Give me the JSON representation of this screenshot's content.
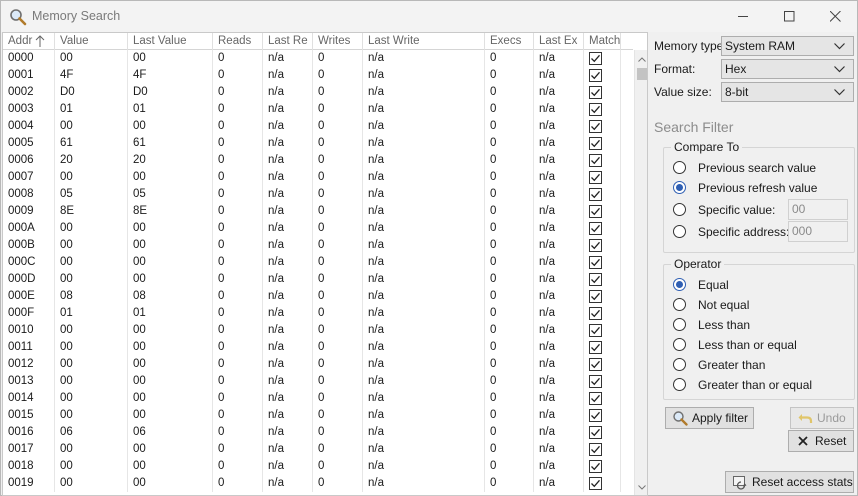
{
  "window": {
    "title": "Memory Search",
    "icon": "magnifier-icon",
    "controls": [
      "minimize-icon",
      "maximize-icon",
      "close-icon"
    ]
  },
  "grid": {
    "columns": [
      "Addr",
      "Value",
      "Last Value",
      "Reads",
      "Last Re",
      "Writes",
      "Last Write",
      "Execs",
      "Last Ex",
      "Match"
    ],
    "sort_icon": "sort-ascending-arrow-icon",
    "rows": [
      {
        "addr": "0000",
        "value": "00",
        "last_value": "00",
        "reads": "0",
        "last_read": "n/a",
        "writes": "0",
        "last_write": "n/a",
        "execs": "0",
        "last_exec": "n/a",
        "match": true
      },
      {
        "addr": "0001",
        "value": "4F",
        "last_value": "4F",
        "reads": "0",
        "last_read": "n/a",
        "writes": "0",
        "last_write": "n/a",
        "execs": "0",
        "last_exec": "n/a",
        "match": true
      },
      {
        "addr": "0002",
        "value": "D0",
        "last_value": "D0",
        "reads": "0",
        "last_read": "n/a",
        "writes": "0",
        "last_write": "n/a",
        "execs": "0",
        "last_exec": "n/a",
        "match": true
      },
      {
        "addr": "0003",
        "value": "01",
        "last_value": "01",
        "reads": "0",
        "last_read": "n/a",
        "writes": "0",
        "last_write": "n/a",
        "execs": "0",
        "last_exec": "n/a",
        "match": true
      },
      {
        "addr": "0004",
        "value": "00",
        "last_value": "00",
        "reads": "0",
        "last_read": "n/a",
        "writes": "0",
        "last_write": "n/a",
        "execs": "0",
        "last_exec": "n/a",
        "match": true
      },
      {
        "addr": "0005",
        "value": "61",
        "last_value": "61",
        "reads": "0",
        "last_read": "n/a",
        "writes": "0",
        "last_write": "n/a",
        "execs": "0",
        "last_exec": "n/a",
        "match": true
      },
      {
        "addr": "0006",
        "value": "20",
        "last_value": "20",
        "reads": "0",
        "last_read": "n/a",
        "writes": "0",
        "last_write": "n/a",
        "execs": "0",
        "last_exec": "n/a",
        "match": true
      },
      {
        "addr": "0007",
        "value": "00",
        "last_value": "00",
        "reads": "0",
        "last_read": "n/a",
        "writes": "0",
        "last_write": "n/a",
        "execs": "0",
        "last_exec": "n/a",
        "match": true
      },
      {
        "addr": "0008",
        "value": "05",
        "last_value": "05",
        "reads": "0",
        "last_read": "n/a",
        "writes": "0",
        "last_write": "n/a",
        "execs": "0",
        "last_exec": "n/a",
        "match": true
      },
      {
        "addr": "0009",
        "value": "8E",
        "last_value": "8E",
        "reads": "0",
        "last_read": "n/a",
        "writes": "0",
        "last_write": "n/a",
        "execs": "0",
        "last_exec": "n/a",
        "match": true
      },
      {
        "addr": "000A",
        "value": "00",
        "last_value": "00",
        "reads": "0",
        "last_read": "n/a",
        "writes": "0",
        "last_write": "n/a",
        "execs": "0",
        "last_exec": "n/a",
        "match": true
      },
      {
        "addr": "000B",
        "value": "00",
        "last_value": "00",
        "reads": "0",
        "last_read": "n/a",
        "writes": "0",
        "last_write": "n/a",
        "execs": "0",
        "last_exec": "n/a",
        "match": true
      },
      {
        "addr": "000C",
        "value": "00",
        "last_value": "00",
        "reads": "0",
        "last_read": "n/a",
        "writes": "0",
        "last_write": "n/a",
        "execs": "0",
        "last_exec": "n/a",
        "match": true
      },
      {
        "addr": "000D",
        "value": "00",
        "last_value": "00",
        "reads": "0",
        "last_read": "n/a",
        "writes": "0",
        "last_write": "n/a",
        "execs": "0",
        "last_exec": "n/a",
        "match": true
      },
      {
        "addr": "000E",
        "value": "08",
        "last_value": "08",
        "reads": "0",
        "last_read": "n/a",
        "writes": "0",
        "last_write": "n/a",
        "execs": "0",
        "last_exec": "n/a",
        "match": true
      },
      {
        "addr": "000F",
        "value": "01",
        "last_value": "01",
        "reads": "0",
        "last_read": "n/a",
        "writes": "0",
        "last_write": "n/a",
        "execs": "0",
        "last_exec": "n/a",
        "match": true
      },
      {
        "addr": "0010",
        "value": "00",
        "last_value": "00",
        "reads": "0",
        "last_read": "n/a",
        "writes": "0",
        "last_write": "n/a",
        "execs": "0",
        "last_exec": "n/a",
        "match": true
      },
      {
        "addr": "0011",
        "value": "00",
        "last_value": "00",
        "reads": "0",
        "last_read": "n/a",
        "writes": "0",
        "last_write": "n/a",
        "execs": "0",
        "last_exec": "n/a",
        "match": true
      },
      {
        "addr": "0012",
        "value": "00",
        "last_value": "00",
        "reads": "0",
        "last_read": "n/a",
        "writes": "0",
        "last_write": "n/a",
        "execs": "0",
        "last_exec": "n/a",
        "match": true
      },
      {
        "addr": "0013",
        "value": "00",
        "last_value": "00",
        "reads": "0",
        "last_read": "n/a",
        "writes": "0",
        "last_write": "n/a",
        "execs": "0",
        "last_exec": "n/a",
        "match": true
      },
      {
        "addr": "0014",
        "value": "00",
        "last_value": "00",
        "reads": "0",
        "last_read": "n/a",
        "writes": "0",
        "last_write": "n/a",
        "execs": "0",
        "last_exec": "n/a",
        "match": true
      },
      {
        "addr": "0015",
        "value": "00",
        "last_value": "00",
        "reads": "0",
        "last_read": "n/a",
        "writes": "0",
        "last_write": "n/a",
        "execs": "0",
        "last_exec": "n/a",
        "match": true
      },
      {
        "addr": "0016",
        "value": "06",
        "last_value": "06",
        "reads": "0",
        "last_read": "n/a",
        "writes": "0",
        "last_write": "n/a",
        "execs": "0",
        "last_exec": "n/a",
        "match": true
      },
      {
        "addr": "0017",
        "value": "00",
        "last_value": "00",
        "reads": "0",
        "last_read": "n/a",
        "writes": "0",
        "last_write": "n/a",
        "execs": "0",
        "last_exec": "n/a",
        "match": true
      },
      {
        "addr": "0018",
        "value": "00",
        "last_value": "00",
        "reads": "0",
        "last_read": "n/a",
        "writes": "0",
        "last_write": "n/a",
        "execs": "0",
        "last_exec": "n/a",
        "match": true
      },
      {
        "addr": "0019",
        "value": "00",
        "last_value": "00",
        "reads": "0",
        "last_read": "n/a",
        "writes": "0",
        "last_write": "n/a",
        "execs": "0",
        "last_exec": "n/a",
        "match": true
      }
    ]
  },
  "settings": {
    "memory_type": {
      "label": "Memory type:",
      "value": "System RAM"
    },
    "format": {
      "label": "Format:",
      "value": "Hex"
    },
    "value_size": {
      "label": "Value size:",
      "value": "8-bit"
    }
  },
  "search_filter": {
    "title": "Search Filter",
    "compare_to": {
      "title": "Compare To",
      "options": [
        "Previous search value",
        "Previous refresh value",
        "Specific value:",
        "Specific address:"
      ],
      "selected": 1,
      "specific_value": "00",
      "specific_address": "000"
    },
    "operator": {
      "title": "Operator",
      "options": [
        "Equal",
        "Not equal",
        "Less than",
        "Less than or equal",
        "Greater than",
        "Greater than or equal"
      ],
      "selected": 0
    }
  },
  "buttons": {
    "apply_filter": "Apply filter",
    "undo": "Undo",
    "reset": "Reset",
    "reset_access_stats": "Reset access stats"
  },
  "colors": {
    "accent_radio": "#2f5fb3",
    "window_bg": "#f0f0f0"
  }
}
